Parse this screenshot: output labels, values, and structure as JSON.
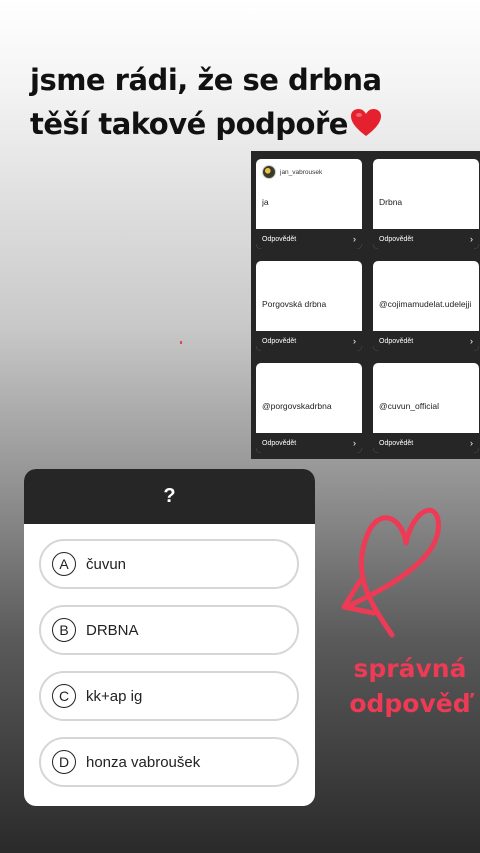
{
  "story": {
    "headline_line1": "jsme rádi, že se drbna",
    "headline_line2": "těší takové podpoře",
    "heart_emoji": "red-heart-icon"
  },
  "replies": {
    "footer_label": "Odpovědět",
    "items": [
      {
        "username": "jan_vabrousek",
        "text": "ja",
        "has_avatar": true
      },
      {
        "text": "Drbna"
      },
      {
        "text": "Porgovská drbna"
      },
      {
        "text": "@cojimamudelat.udelejji"
      },
      {
        "text": "@porgovskadrbna"
      },
      {
        "text": "@cuvun_official"
      }
    ]
  },
  "quiz": {
    "question": "?",
    "options": [
      {
        "letter": "A",
        "label": "čuvun"
      },
      {
        "letter": "B",
        "label": "DRBNA"
      },
      {
        "letter": "C",
        "label": "kk+ap ig"
      },
      {
        "letter": "D",
        "label": "honza vabroušek"
      }
    ]
  },
  "annotation": {
    "line1": "správná",
    "line2": "odpověď",
    "color": "#ee3a55",
    "icon": "heart-arrow-doodle-icon"
  }
}
